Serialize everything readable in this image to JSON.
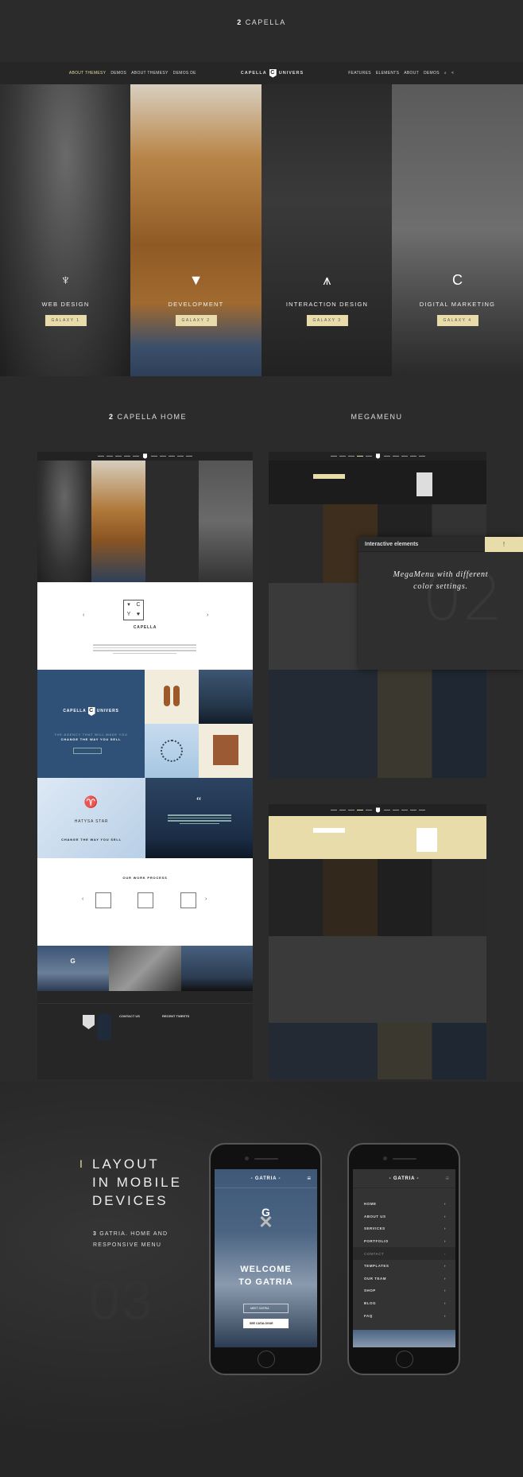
{
  "header": {
    "number": "2",
    "title": "CAPELLA"
  },
  "topnav": {
    "left": [
      "ABOUT THEMESY",
      "DEMOS",
      "ABOUT THEMESY",
      "DEMOS DE"
    ],
    "logo_left": "CAPELLA",
    "logo_letter": "C",
    "logo_right": "UNIVERS",
    "right": [
      "FEATURES",
      "ELEMENTS",
      "ABOUT",
      "DEMOS"
    ],
    "search_icon": "search-icon",
    "share_icon": "share-icon"
  },
  "hero": [
    {
      "title": "WEB DESIGN",
      "button": "GALAXY 1",
      "icon": "deer-head-icon"
    },
    {
      "title": "DEVELOPMENT",
      "button": "GALAXY 2",
      "icon": "fox-head-icon"
    },
    {
      "title": "INTERACTION DESIGN",
      "button": "GALAXY 3",
      "icon": "eagle-icon"
    },
    {
      "title": "DIGITAL MARKETING",
      "button": "GALAXY 4",
      "icon": "wave-c-icon"
    }
  ],
  "button_color": "#e8dcaa",
  "sections": {
    "home_number": "2",
    "home": "CAPELLA HOME",
    "megamenu": "MEGAMENU"
  },
  "home_mock": {
    "capella": "CAPELLA",
    "univers_left": "CAPELLA",
    "univers_letter": "C",
    "univers_right": "UNIVERS",
    "agency": "THE AGENCY THAT WILL MAKE YOU",
    "change": "CHANGE THE WAY YOU SELL",
    "hatysa": "HATYSA STAR",
    "hatysa_change": "CHANGE THE WAY YOU SELL",
    "quote": "“",
    "process": "OUR WORK PROCESS",
    "contact": "CONTACT US",
    "tweets": "RECENT TWEETS",
    "gatria": "G"
  },
  "interactive": {
    "title": "Interactive elements",
    "badge": "!",
    "number": "02",
    "caption_line1": "MegaMenu with different",
    "caption_line2": "color settings."
  },
  "mobile": {
    "bar": "I",
    "title_lines": [
      "LAYOUT",
      "IN MOBILE",
      "DEVICES"
    ],
    "sub_number": "3",
    "sub_line1": "GATRIA. HOME AND",
    "sub_line2": "RESPONSIVE MENU",
    "big_number": "03"
  },
  "phone1": {
    "brand": "- GATRIA -",
    "logo": "G",
    "welcome_line1": "WELCOME",
    "welcome_line2": "TO GATRIA",
    "btn1": "MEET GATRIA",
    "btn2": "SEE CATALOGUE"
  },
  "phone2": {
    "brand": "- GATRIA -",
    "menu": [
      "HOME",
      "ABOUT US",
      "SERVICES",
      "PORTFOLIO",
      "CONTACT",
      "TEMPLATES",
      "OUR TEAM",
      "SHOP",
      "BLOG",
      "FAQ"
    ],
    "active": "CONTACT"
  }
}
